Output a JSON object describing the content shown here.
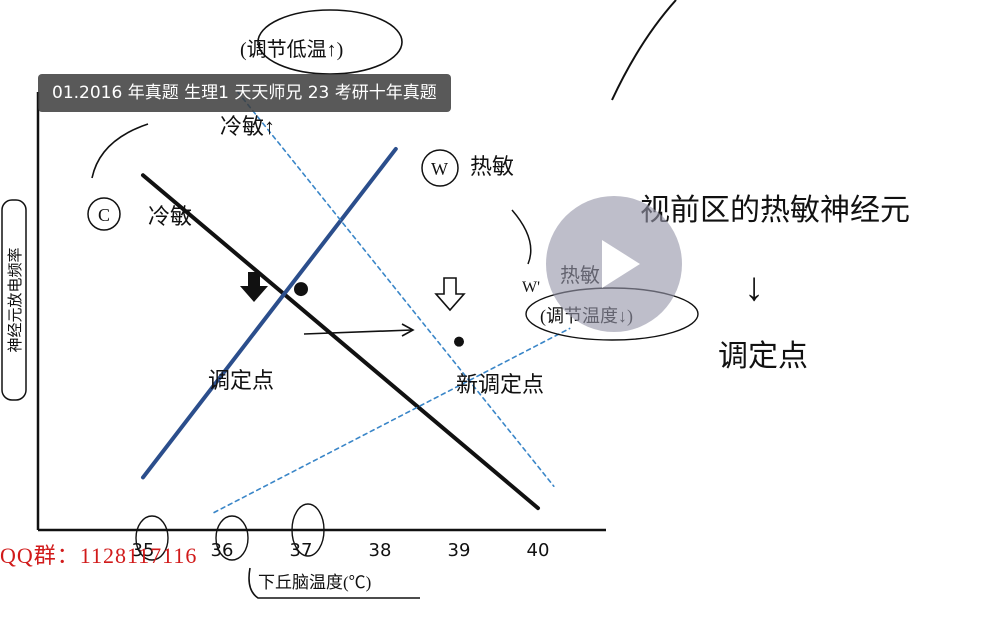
{
  "video": {
    "title": "01.2016 年真题 生理1 天天师兄 23 考研十年真题"
  },
  "watermark": {
    "qq_label": "QQ群：1128117116"
  },
  "chart_data": {
    "type": "line",
    "xlabel": "下丘脑温度(℃)",
    "ylabel": "神经元放电频率",
    "x_ticks": [
      "35",
      "36",
      "37",
      "38",
      "39",
      "40"
    ],
    "series": [
      {
        "name": "C 冷敏",
        "style": "solid-black",
        "x": [
          35,
          40
        ],
        "y": [
          0.81,
          0.05
        ]
      },
      {
        "name": "W 热敏",
        "style": "solid-blue",
        "x": [
          35,
          38.2
        ],
        "y": [
          0.12,
          0.87
        ]
      },
      {
        "name": "冷敏 (调节后)",
        "style": "dashed-blue",
        "x": [
          36.2,
          40.2
        ],
        "y": [
          1.0,
          0.1
        ]
      },
      {
        "name": "热敏 (调节后)",
        "style": "dashed-blue",
        "x": [
          35.9,
          40.4
        ],
        "y": [
          0.04,
          0.46
        ]
      }
    ],
    "points": [
      {
        "label": "调定点",
        "x": 37.0,
        "y": 0.55
      },
      {
        "label": "新调定点",
        "x": 39.0,
        "y": 0.43
      }
    ]
  },
  "annotations": {
    "top": "(调节低温↑)",
    "top2": "冷敏↑",
    "c_label": "C",
    "c_text": "冷敏",
    "w_label": "W",
    "w_text": "热敏",
    "w2_label": "W'",
    "w2_text": "热敏",
    "w2_paren": "(调节温度↓)",
    "set_point": "调定点",
    "new_set_point": "新调定点",
    "right_line1": "视前区的热敏神经元",
    "right_arrow": "↓",
    "right_line2": "调定点"
  },
  "controls": {
    "play_icon": "play-icon"
  },
  "colors": {
    "axis": "#111111",
    "cold_line": "#111111",
    "warm_line": "#2b4e8c",
    "dashed": "#3a86c8",
    "watermark": "#d11a1a"
  }
}
